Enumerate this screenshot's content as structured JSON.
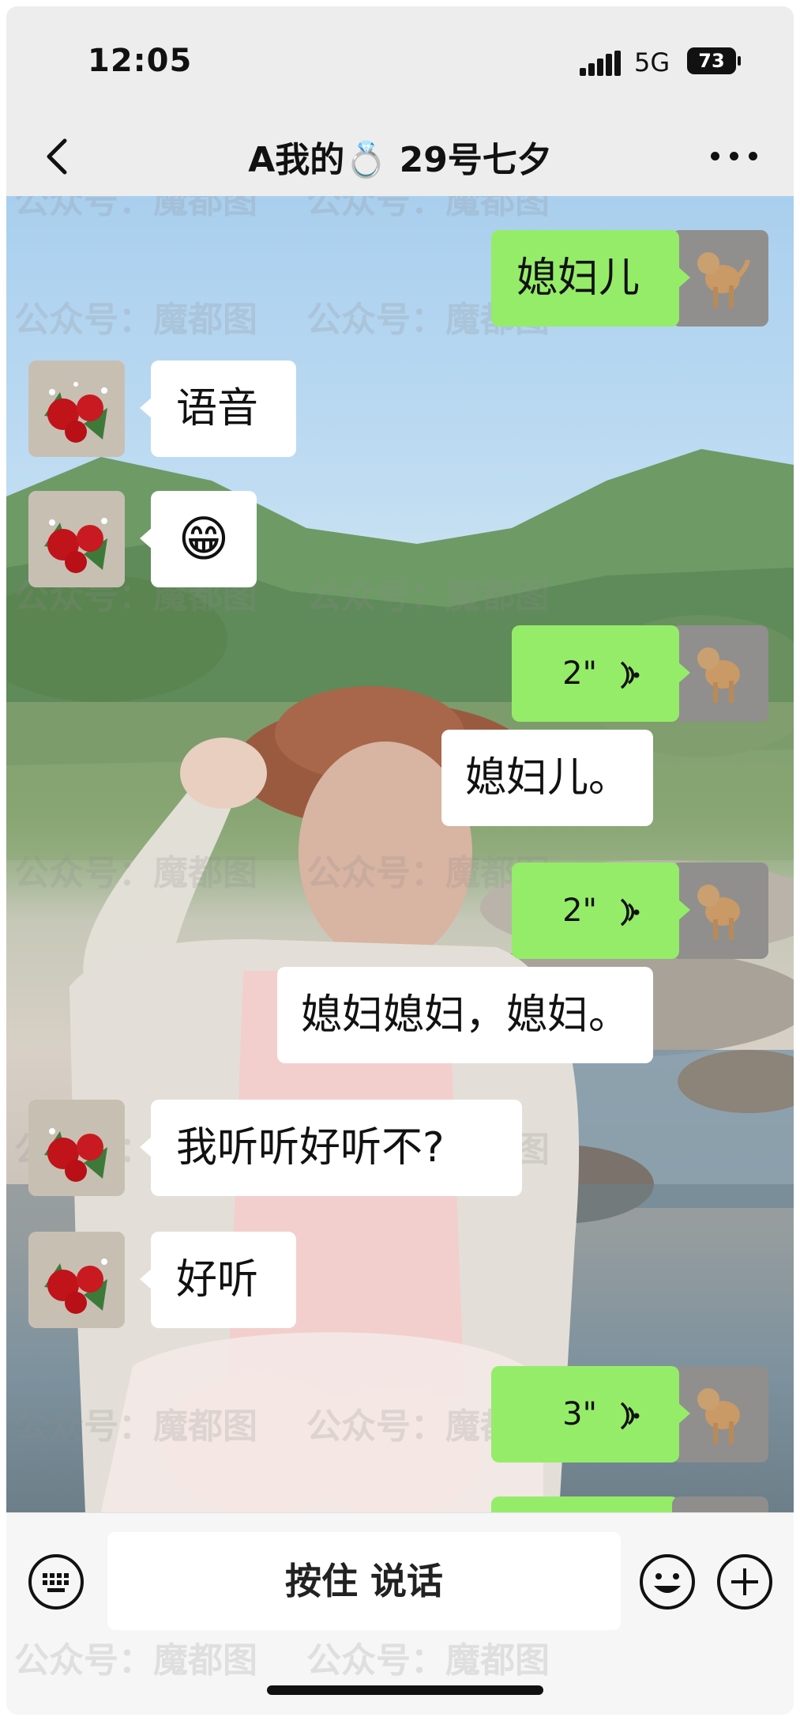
{
  "status_bar": {
    "time": "12:05",
    "network": "5G",
    "battery": "73"
  },
  "header": {
    "title_prefix": "A我的",
    "title_emoji": "💍",
    "title_suffix": "29号七夕"
  },
  "messages": [
    {
      "side": "right",
      "type": "text",
      "text": "媳妇儿"
    },
    {
      "side": "left",
      "type": "text",
      "text": "语音"
    },
    {
      "side": "left",
      "type": "emoji",
      "text": "😁"
    },
    {
      "side": "right",
      "type": "voice",
      "duration": "2\"",
      "transcript": "媳妇儿。"
    },
    {
      "side": "right",
      "type": "voice",
      "duration": "2\"",
      "transcript": "媳妇媳妇，媳妇。"
    },
    {
      "side": "left",
      "type": "text",
      "text": "我听听好听不?"
    },
    {
      "side": "left",
      "type": "text",
      "text": "好听"
    },
    {
      "side": "right",
      "type": "voice",
      "duration": "3\""
    }
  ],
  "watermark_text": "公众号：魔都图",
  "input_bar": {
    "hold_to_talk_label": "按住 说话"
  },
  "colors": {
    "sent_bubble": "#95ec69",
    "received_bubble": "#ffffff",
    "chrome_bg": "#ededed"
  },
  "icons": [
    "back-arrow-icon",
    "more-icon",
    "keyboard-icon",
    "emoji-icon",
    "plus-icon",
    "voice-wave-icon"
  ]
}
